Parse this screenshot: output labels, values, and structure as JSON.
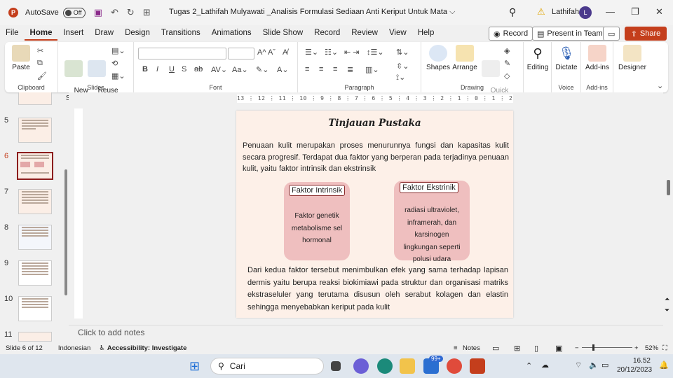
{
  "titlebar": {
    "autosave": "AutoSave",
    "toggle": "Off",
    "doc_title": "Tugas 2_Lathifah Mulyawati _Analisis Formulasi Sediaan Anti Keriput Untuk Mata ⌵",
    "user": "Lathifah",
    "avatar": "L"
  },
  "menu": [
    "File",
    "Home",
    "Insert",
    "Draw",
    "Design",
    "Transitions",
    "Animations",
    "Slide Show",
    "Record",
    "Review",
    "View",
    "Help"
  ],
  "menu_active": "Home",
  "top_buttons": {
    "record": "Record",
    "teams": "Present in Teams",
    "share": "Share"
  },
  "ribbon": {
    "clipboard": {
      "paste": "Paste",
      "label": "Clipboard"
    },
    "slides": {
      "new_slide": "New\nSlide",
      "reuse": "Reuse\nSlides",
      "label": "Slides"
    },
    "font": {
      "label": "Font"
    },
    "paragraph": {
      "label": "Paragraph"
    },
    "drawing": {
      "shapes": "Shapes",
      "arrange": "Arrange",
      "quick": "Quick\nStyles",
      "label": "Drawing"
    },
    "editing": "Editing",
    "voice": {
      "dictate": "Dictate",
      "label": "Voice"
    },
    "addins": {
      "addins": "Add-ins",
      "label": "Add-ins"
    },
    "designer": "Designer"
  },
  "thumbnails": [
    "5",
    "6",
    "7",
    "8",
    "9",
    "10",
    "11"
  ],
  "ruler_text": "13 ⋮ 12 ⋮ 11 ⋮ 10 ⋮ 9 ⋮ 8 ⋮ 7 ⋮ 6 ⋮ 5 ⋮ 4 ⋮ 3 ⋮ 2 ⋮ 1 ⋮ 0 ⋮ 1 ⋮ 2 ⋮ 3 ⋮ 4 ⋮ 5 ⋮ 6 ⋮ 7 ⋮ 8 ⋮ 9 ⋮ 10 ⋮ 11 ⋮ 12 ⋮ 13",
  "slide": {
    "title": "Tinjauan Pustaka",
    "para1": "Penuaan kulit merupakan proses menurunnya fungsi dan kapasitas kulit secara progresif. Terdapat dua faktor yang berperan pada terjadinya penuaan kulit, yaitu faktor intrinsik dan ekstrinsik",
    "card1_title": "Faktor Intrinsik",
    "card1_text": "Faktor genetik metabolisme sel hormonal",
    "card2_title": "Faktor Ekstrinik",
    "card2_text": "radiasi ultraviolet, inframerah, dan karsinogen lingkungan seperti polusi udara",
    "para2": "Dari kedua faktor tersebut menimbulkan efek yang sama terhadap  lapisan dermis yaitu berupa reaksi biokimiawi pada struktur dan organisasi matriks ekstraseluler yang terutama disusun oleh serabut kolagen dan elastin sehingga menyebabkan keriput pada kulit"
  },
  "notes_placeholder": "Click to add notes",
  "status": {
    "slide": "Slide 6 of 12",
    "language": "Indonesian",
    "accessibility": "Accessibility: Investigate",
    "notes": "Notes",
    "zoom": "52%"
  },
  "taskbar": {
    "search": "Cari",
    "badge": "99+",
    "time": "16.52",
    "date": "20/12/2023"
  },
  "colors": {
    "accent": "#c43e1c",
    "card": "#efbfbf",
    "slide_bg": "#fdf0e8"
  }
}
